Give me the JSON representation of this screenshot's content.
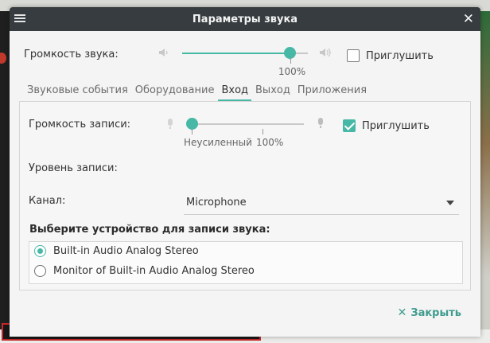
{
  "window": {
    "title": "Параметры звука",
    "menu_icon": "hamburger-menu-icon",
    "close_icon": "close-icon"
  },
  "output_volume": {
    "label": "Громкость звука:",
    "value_percent": 86,
    "scale_mark": "100%",
    "mute_label": "Приглушить",
    "muted": false
  },
  "tabs": [
    {
      "label": "Звуковые события"
    },
    {
      "label": "Оборудование"
    },
    {
      "label": "Вход",
      "active": true
    },
    {
      "label": "Выход"
    },
    {
      "label": "Приложения"
    }
  ],
  "input": {
    "record_volume_label": "Громкость записи:",
    "value_percent": 0,
    "mark_unamplified": "Неусиленный",
    "mark_100": "100%",
    "mute_label": "Приглушить",
    "muted": true,
    "record_level_label": "Уровень записи:",
    "channel_label": "Канал:",
    "channel_value": "Microphone",
    "device_section_title": "Выберите устройство для записи звука:",
    "devices": [
      {
        "label": "Built-in Audio Analog Stereo",
        "selected": true
      },
      {
        "label": "Monitor of Built-in Audio Analog Stereo",
        "selected": false
      }
    ]
  },
  "footer": {
    "close_label": "Закрыть"
  },
  "colors": {
    "accent": "#48b8a6",
    "titlebar": "#363c3f"
  }
}
